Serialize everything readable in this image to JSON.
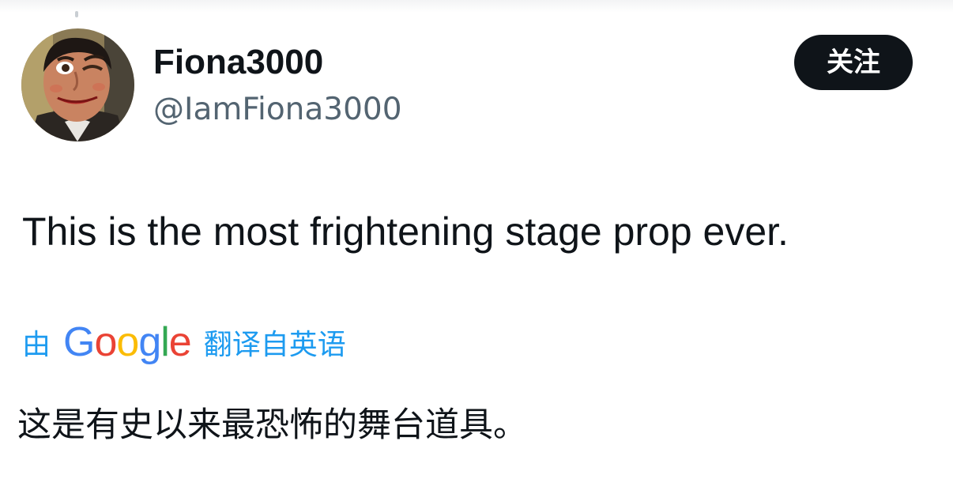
{
  "user": {
    "display_name": "Fiona3000",
    "handle": "@IamFiona3000",
    "avatar": "ventriloquist-dummy-avatar"
  },
  "follow_button": {
    "label": "关注"
  },
  "tweet": {
    "text": "This is the most frightening stage prop ever."
  },
  "translation": {
    "prefix": "由",
    "provider_letters": [
      "G",
      "o",
      "o",
      "g",
      "l",
      "e"
    ],
    "suffix": "翻译自英语",
    "translated_text": "这是有史以来最恐怖的舞台道具。"
  },
  "colors": {
    "text_primary": "#0f1419",
    "text_secondary": "#536471",
    "link_blue": "#1d9bf0",
    "button_bg": "#0f1419",
    "google_blue": "#4285f4",
    "google_red": "#ea4335",
    "google_yellow": "#fbbc05",
    "google_green": "#34a853"
  }
}
